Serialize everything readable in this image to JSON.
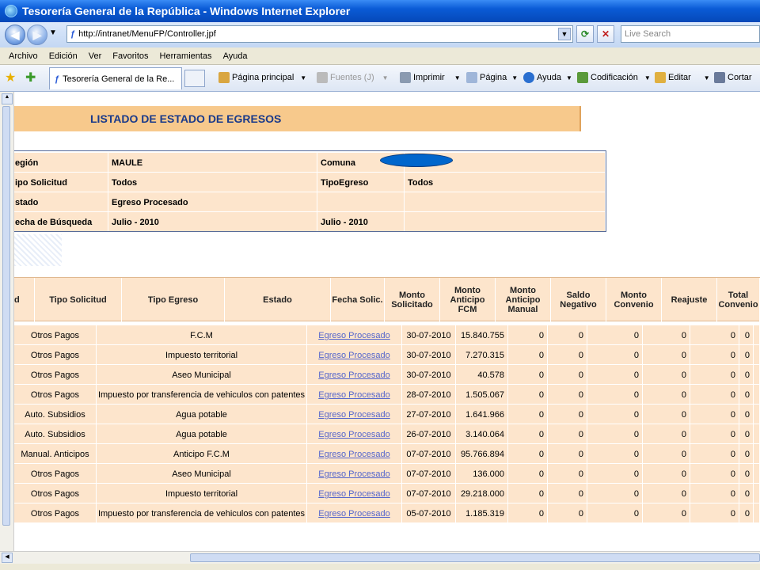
{
  "window": {
    "title": "Tesorería General de la República - Windows Internet Explorer"
  },
  "address": {
    "url": "http://intranet/MenuFP/Controller.jpf",
    "search_placeholder": "Live Search"
  },
  "menu": [
    "Archivo",
    "Edición",
    "Ver",
    "Favoritos",
    "Herramientas",
    "Ayuda"
  ],
  "toolbar": {
    "tab_label": "Tesorería General de la Re...",
    "home": "Página principal",
    "feeds": "Fuentes (J)",
    "print": "Imprimir",
    "page": "Página",
    "help": "Ayuda",
    "encoding": "Codificación",
    "edit": "Editar",
    "cut": "Cortar"
  },
  "page": {
    "title": "LISTADO DE ESTADO DE EGRESOS"
  },
  "filters": [
    [
      "egión",
      "MAULE",
      "Comuna",
      ""
    ],
    [
      "ipo Solicitud",
      "Todos",
      "TipoEgreso",
      "Todos"
    ],
    [
      "stado",
      "Egreso Procesado",
      "",
      ""
    ],
    [
      "echa de Búsqueda",
      "Julio - 2010",
      "Julio - 2010",
      ""
    ]
  ],
  "grid": {
    "headers": [
      "d",
      "Tipo Solicitud",
      "Tipo Egreso",
      "Estado",
      "Fecha Solic.",
      "Monto Solicitado",
      "Monto Anticipo FCM",
      "Monto Anticipo Manual",
      "Saldo Negativo",
      "Monto Convenio",
      "Reajuste",
      "Total Convenio"
    ],
    "rows": [
      [
        "Otros Pagos",
        "F.C.M",
        "Egreso Procesado",
        "30-07-2010",
        "15.840.755",
        "0",
        "0",
        "0",
        "0",
        "0",
        "0"
      ],
      [
        "Otros Pagos",
        "Impuesto territorial",
        "Egreso Procesado",
        "30-07-2010",
        "7.270.315",
        "0",
        "0",
        "0",
        "0",
        "0",
        "0"
      ],
      [
        "Otros Pagos",
        "Aseo Municipal",
        "Egreso Procesado",
        "30-07-2010",
        "40.578",
        "0",
        "0",
        "0",
        "0",
        "0",
        "0"
      ],
      [
        "Otros Pagos",
        "Impuesto por transferencia de vehiculos con patentes",
        "Egreso Procesado",
        "28-07-2010",
        "1.505.067",
        "0",
        "0",
        "0",
        "0",
        "0",
        "0"
      ],
      [
        "Auto. Subsidios",
        "Agua potable",
        "Egreso Procesado",
        "27-07-2010",
        "1.641.966",
        "0",
        "0",
        "0",
        "0",
        "0",
        "0"
      ],
      [
        "Auto. Subsidios",
        "Agua potable",
        "Egreso Procesado",
        "26-07-2010",
        "3.140.064",
        "0",
        "0",
        "0",
        "0",
        "0",
        "0"
      ],
      [
        "Manual. Anticipos",
        "Anticipo F.C.M",
        "Egreso Procesado",
        "07-07-2010",
        "95.766.894",
        "0",
        "0",
        "0",
        "0",
        "0",
        "0"
      ],
      [
        "Otros Pagos",
        "Aseo Municipal",
        "Egreso Procesado",
        "07-07-2010",
        "136.000",
        "0",
        "0",
        "0",
        "0",
        "0",
        "0"
      ],
      [
        "Otros Pagos",
        "Impuesto territorial",
        "Egreso Procesado",
        "07-07-2010",
        "29.218.000",
        "0",
        "0",
        "0",
        "0",
        "0",
        "0"
      ],
      [
        "Otros Pagos",
        "Impuesto por transferencia de vehiculos con patentes",
        "Egreso Procesado",
        "05-07-2010",
        "1.185.319",
        "0",
        "0",
        "0",
        "0",
        "0",
        "0"
      ]
    ]
  }
}
